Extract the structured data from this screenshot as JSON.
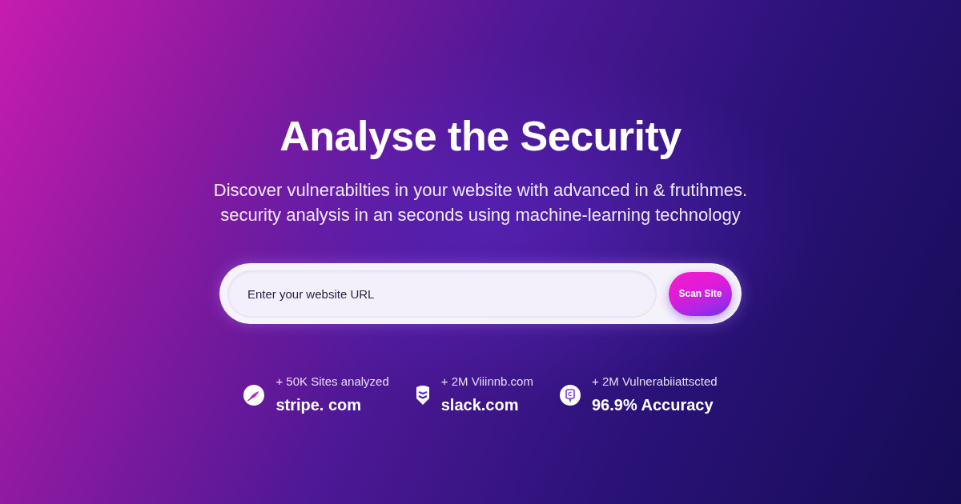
{
  "hero": {
    "title": "Analyse the Security",
    "subtitle_lines": [
      "Discover vulnerabilties in your website with advanced in & frutihmes.",
      "security analysis in an seconds using machine-learning technology"
    ]
  },
  "search": {
    "placeholder": "Enter your website URL",
    "button": "Scan Site"
  },
  "stats": [
    {
      "kind": "feather",
      "caption": "+ 50K Sites analyzed",
      "value": "stripe. com"
    },
    {
      "kind": "shield",
      "caption": "+ 2M Viiinnb.com",
      "value": "slack.com"
    },
    {
      "kind": "badge",
      "caption": "+ 2M Vulnerabiiattscted",
      "value": "96.9% Accuracy"
    }
  ]
}
